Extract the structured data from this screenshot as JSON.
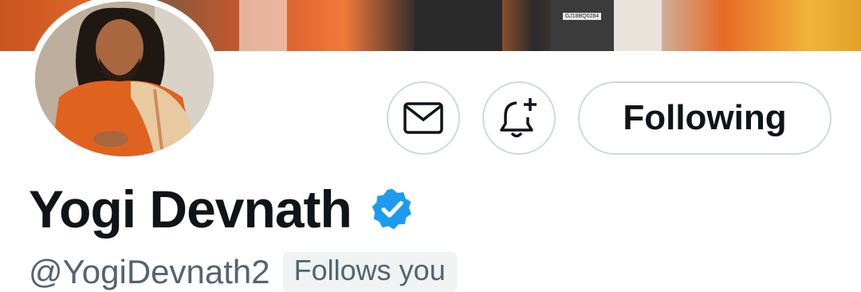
{
  "profile": {
    "display_name": "Yogi Devnath",
    "handle": "@YogiDevnath2",
    "follows_you_label": "Follows you",
    "verified": true,
    "verified_color": "#1d9bf0"
  },
  "actions": {
    "message_icon": "envelope-icon",
    "notify_icon": "bell-plus-icon",
    "following_label": "Following"
  },
  "banner": {
    "plate_text": "GJ18BQ0284"
  }
}
